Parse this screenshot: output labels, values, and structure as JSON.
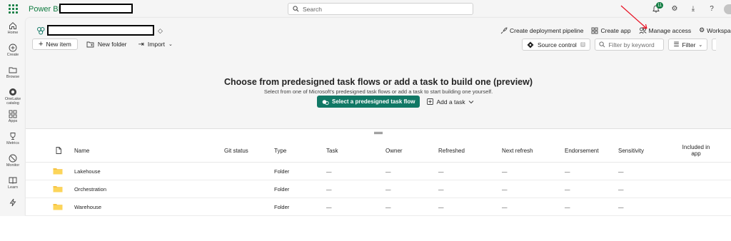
{
  "app": {
    "brand": "Power BI"
  },
  "search": {
    "placeholder": "Search"
  },
  "top_icons": [
    {
      "name": "notifications-icon",
      "glyph": "🔔",
      "badge": "11"
    },
    {
      "name": "settings-icon",
      "glyph": "⚙"
    },
    {
      "name": "download-icon",
      "glyph": "⤓"
    },
    {
      "name": "help-icon",
      "glyph": "?"
    }
  ],
  "nav": {
    "items": [
      {
        "label": "Home",
        "icon": "home-icon"
      },
      {
        "label": "Create",
        "icon": "create-icon"
      },
      {
        "label": "Browse",
        "icon": "browse-icon"
      },
      {
        "label": "OneLake catalog",
        "icon": "onelake-icon"
      },
      {
        "label": "Apps",
        "icon": "apps-icon"
      },
      {
        "label": "Metrics",
        "icon": "metrics-icon"
      },
      {
        "label": "Monitor",
        "icon": "monitor-icon"
      },
      {
        "label": "Learn",
        "icon": "learn-icon"
      },
      {
        "label": "",
        "icon": "lightning-icon"
      }
    ]
  },
  "workspace": {
    "actions": {
      "deployment": "Create deployment pipeline",
      "create_app": "Create app",
      "manage_access": "Manage access",
      "workspace": "Workspace"
    }
  },
  "toolbar": {
    "new_item": "New item",
    "new_folder": "New folder",
    "import": "Import",
    "source_control": "Source control",
    "source_control_count": "0",
    "filter_placeholder": "Filter by keyword",
    "filter": "Filter"
  },
  "hero": {
    "title": "Choose from predesigned task flows or add a task to build one (preview)",
    "subtitle": "Select from one of Microsoft's predesigned task flows or add a task to start building one yourself.",
    "primary": "Select a predesigned task flow",
    "add_task": "Add a task"
  },
  "table": {
    "headers": {
      "name": "Name",
      "git": "Git status",
      "type": "Type",
      "task": "Task",
      "owner": "Owner",
      "refreshed": "Refreshed",
      "next_refresh": "Next refresh",
      "endorsement": "Endorsement",
      "sensitivity": "Sensitivity",
      "included": "Included in app"
    },
    "rows": [
      {
        "name": "Lakehouse",
        "type": "Folder",
        "task": "—",
        "owner": "—",
        "refreshed": "—",
        "next_refresh": "—",
        "endorsement": "—",
        "sensitivity": "—"
      },
      {
        "name": "Orchestration",
        "type": "Folder",
        "task": "—",
        "owner": "—",
        "refreshed": "—",
        "next_refresh": "—",
        "endorsement": "—",
        "sensitivity": "—"
      },
      {
        "name": "Warehouse",
        "type": "Folder",
        "task": "—",
        "owner": "—",
        "refreshed": "—",
        "next_refresh": "—",
        "endorsement": "—",
        "sensitivity": "—"
      }
    ]
  },
  "colors": {
    "brand": "#107c41",
    "primary_button": "#117865",
    "folder": "#f6c342",
    "annotation_arrow": "#e81123"
  }
}
